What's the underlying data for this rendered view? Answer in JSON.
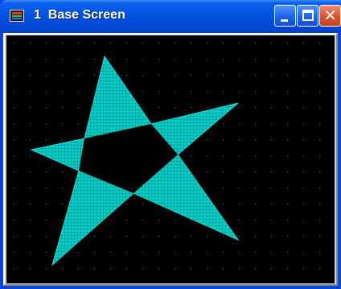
{
  "window": {
    "title": "1  Base Screen",
    "app_icon": "app-window-icon",
    "buttons": {
      "minimize": "minimize-icon",
      "maximize": "maximize-icon",
      "close": "close-icon",
      "close_glyph": "✕"
    }
  },
  "canvas": {
    "background": "#000000",
    "grid_dot_color": "#2e8b57",
    "shape": {
      "type": "five-point star (pentagram)",
      "fill": "#00d0c8",
      "hatch": "#008c88"
    }
  }
}
